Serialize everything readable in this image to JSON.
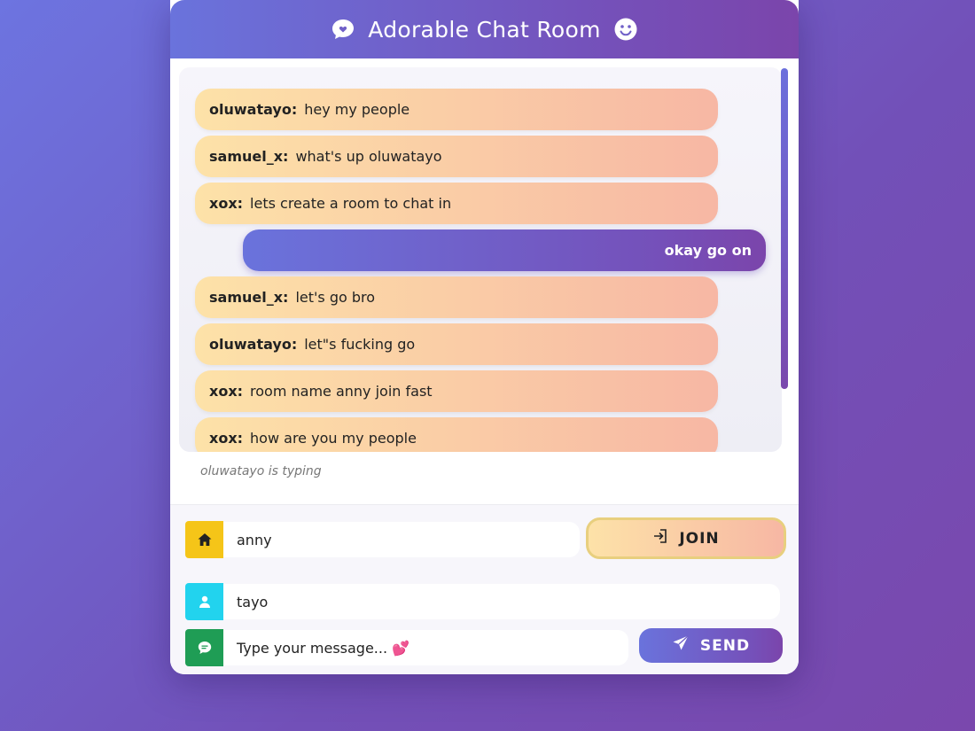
{
  "header": {
    "title": "Adorable Chat Room"
  },
  "messages": [
    {
      "user": "oluwatayo:",
      "text": "hey my people"
    },
    {
      "user": "samuel_x:",
      "text": "what's up oluwatayo"
    },
    {
      "user": "xox:",
      "text": "lets create a room to chat in"
    },
    {
      "mine": true,
      "text": "okay go on"
    },
    {
      "user": "samuel_x:",
      "text": "let's go bro"
    },
    {
      "user": "oluwatayo:",
      "text": "let\"s fucking go"
    },
    {
      "user": "xox:",
      "text": "room name anny join fast"
    },
    {
      "user": "xox:",
      "text": "how are you my people"
    }
  ],
  "typing_indicator": "oluwatayo is typing",
  "room": {
    "value": "anny",
    "icon": "home-icon",
    "icon_color": "#f5c518"
  },
  "join_button": {
    "label": "JOIN",
    "icon": "login-icon"
  },
  "username": {
    "value": "tayo",
    "icon": "user-icon",
    "icon_color": "#22d3ee"
  },
  "message_input": {
    "placeholder": "Type your message... 💕",
    "icon": "chat-icon",
    "icon_color": "#1f9d55"
  },
  "send_button": {
    "label": "SEND",
    "icon": "send-icon"
  },
  "colors": {
    "accent_from": "#6a73dc",
    "accent_to": "#7b45ab",
    "bubble_from": "#fde2a8",
    "bubble_to": "#f7b7a4"
  }
}
